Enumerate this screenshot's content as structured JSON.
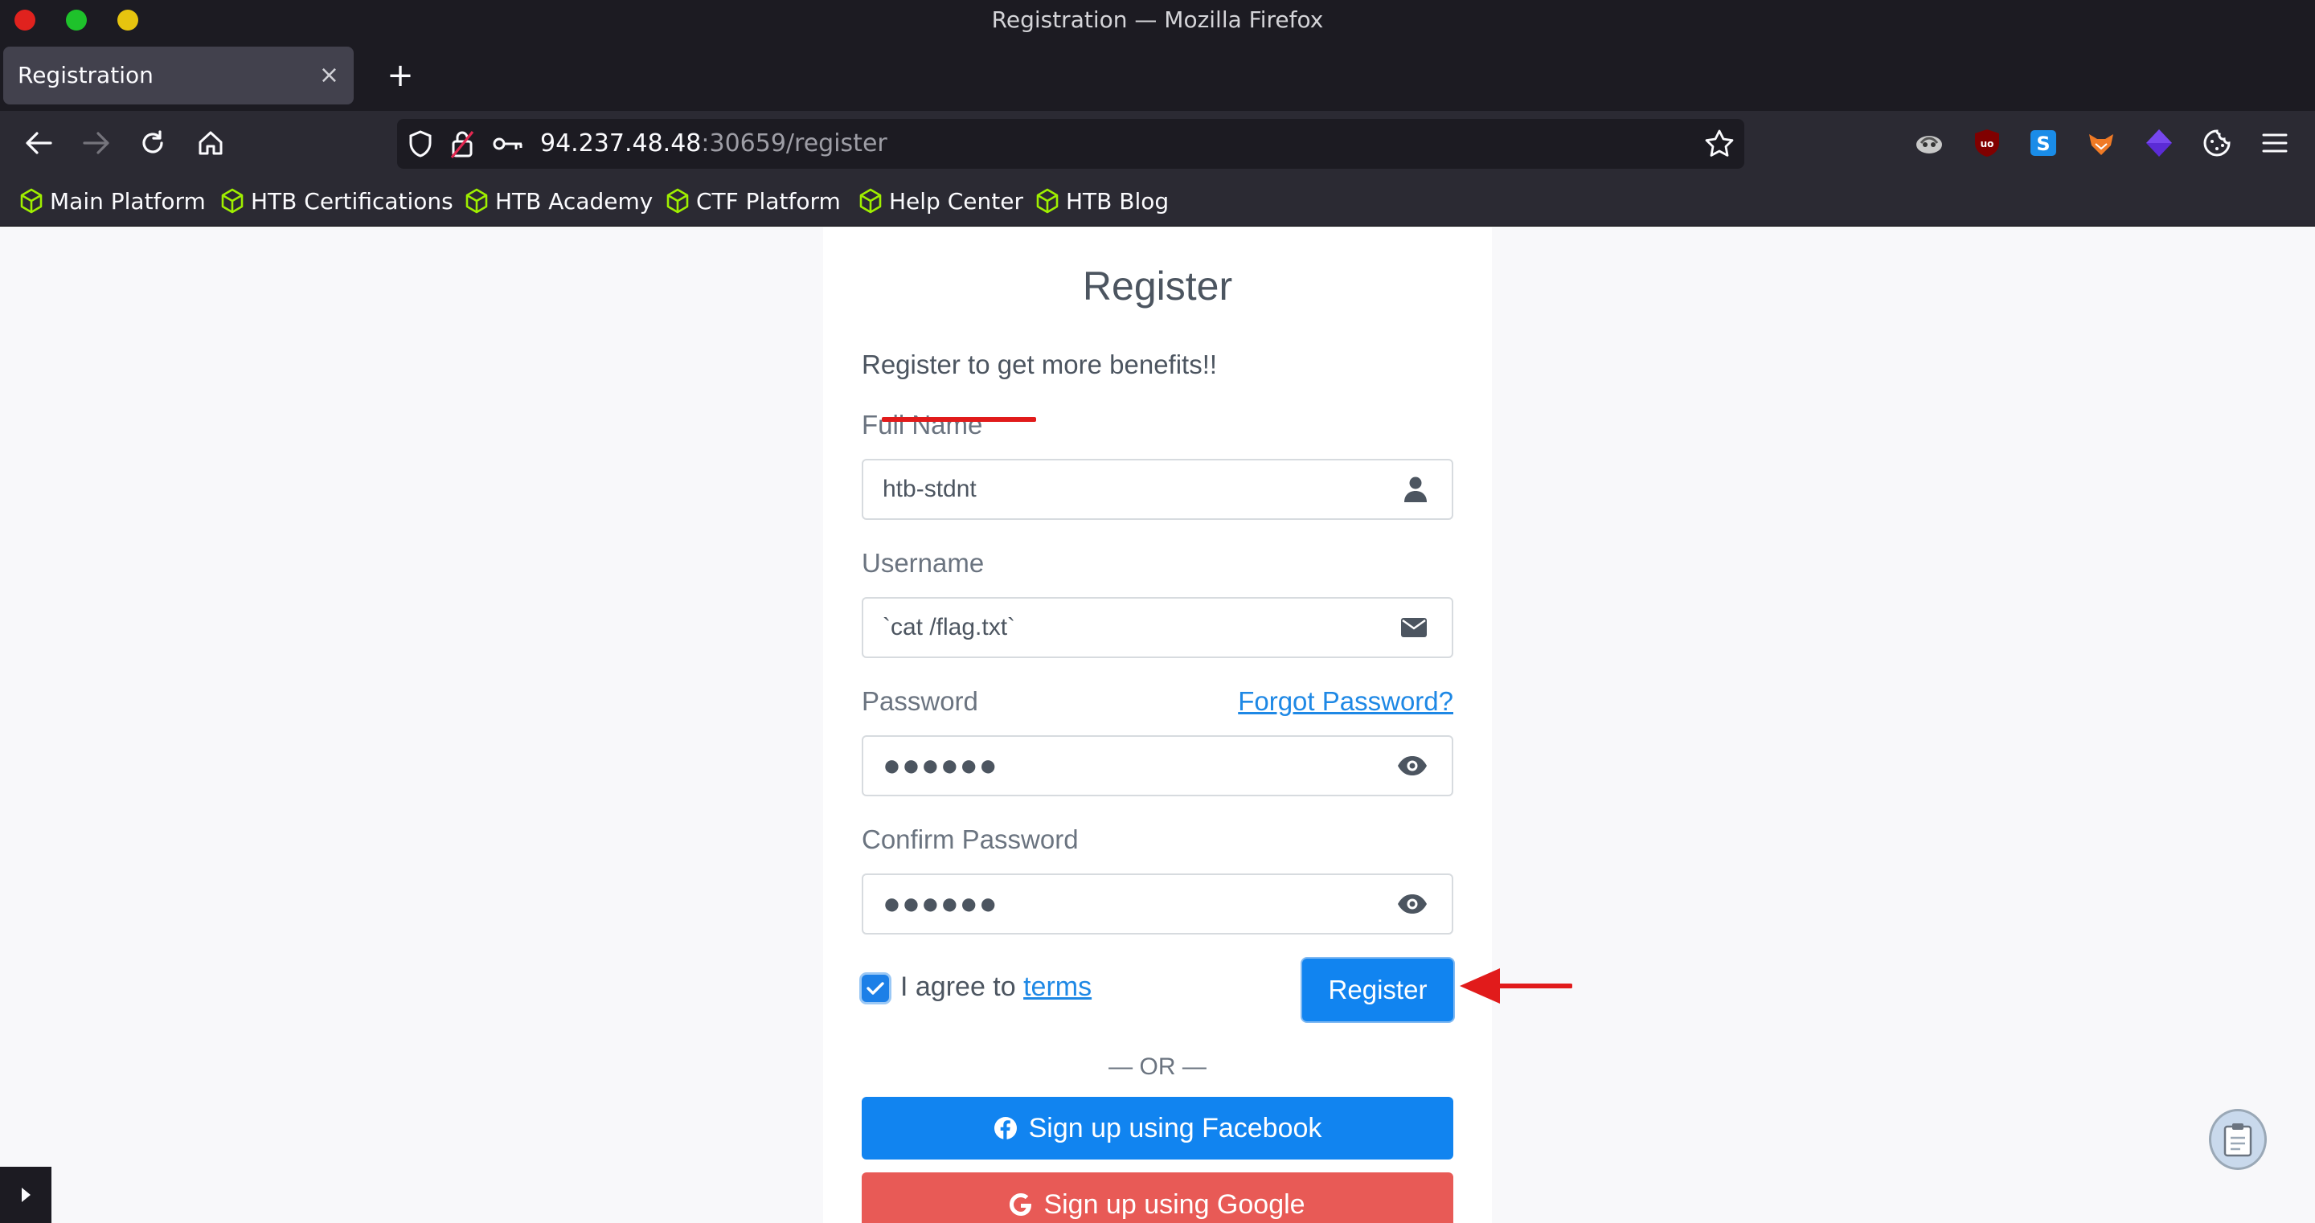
{
  "window": {
    "title": "Registration — Mozilla Firefox"
  },
  "tabs": [
    {
      "title": "Registration",
      "close": "×"
    }
  ],
  "newtab": "+",
  "url": {
    "host": "94.237.48.48",
    "rest": ":30659/register"
  },
  "bookmarks": [
    "Main Platform",
    "HTB Certifications",
    "HTB Academy",
    "CTF Platform",
    "Help Center",
    "HTB Blog"
  ],
  "form": {
    "title": "Register",
    "subtitle": "Register to get more benefits!!",
    "fullname_label": "Full Name",
    "fullname_value": "htb-stdnt",
    "username_label": "Username",
    "username_value": "`cat /flag.txt`",
    "password_label": "Password",
    "forgot_label": "Forgot Password?",
    "password_value": "●●●●●●",
    "confirm_label": "Confirm Password",
    "confirm_value": "●●●●●●",
    "agree_text": "I agree to ",
    "terms_link": "terms",
    "agree_checked": true,
    "register_button": "Register",
    "or_text": "— OR —",
    "facebook_button": "Sign up using Facebook",
    "google_button": "Sign up using Google"
  },
  "colors": {
    "accent": "#1184f0",
    "google": "#e85a56",
    "annotation": "#e11b1b"
  }
}
